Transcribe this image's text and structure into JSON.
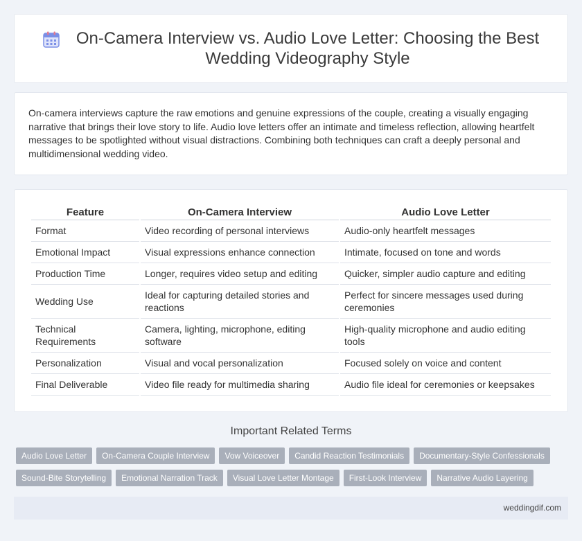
{
  "header": {
    "title": "On-Camera Interview vs. Audio Love Letter: Choosing the Best Wedding Videography Style",
    "icon": "calendar-icon",
    "icon_color": "#7b8fe6"
  },
  "intro": {
    "text": "On-camera interviews capture the raw emotions and genuine expressions of the couple, creating a visually engaging narrative that brings their love story to life. Audio love letters offer an intimate and timeless reflection, allowing heartfelt messages to be spotlighted without visual distractions. Combining both techniques can craft a deeply personal and multidimensional wedding video."
  },
  "table": {
    "headers": [
      "Feature",
      "On-Camera Interview",
      "Audio Love Letter"
    ],
    "rows": [
      [
        "Format",
        "Video recording of personal interviews",
        "Audio-only heartfelt messages"
      ],
      [
        "Emotional Impact",
        "Visual expressions enhance connection",
        "Intimate, focused on tone and words"
      ],
      [
        "Production Time",
        "Longer, requires video setup and editing",
        "Quicker, simpler audio capture and editing"
      ],
      [
        "Wedding Use",
        "Ideal for capturing detailed stories and reactions",
        "Perfect for sincere messages used during ceremonies"
      ],
      [
        "Technical Requirements",
        "Camera, lighting, microphone, editing software",
        "High-quality microphone and audio editing tools"
      ],
      [
        "Personalization",
        "Visual and vocal personalization",
        "Focused solely on voice and content"
      ],
      [
        "Final Deliverable",
        "Video file ready for multimedia sharing",
        "Audio file ideal for ceremonies or keepsakes"
      ]
    ]
  },
  "related": {
    "title": "Important Related Terms",
    "tags": [
      "Audio Love Letter",
      "On-Camera Couple Interview",
      "Vow Voiceover",
      "Candid Reaction Testimonials",
      "Documentary-Style Confessionals",
      "Sound-Bite Storytelling",
      "Emotional Narration Track",
      "Visual Love Letter Montage",
      "First-Look Interview",
      "Narrative Audio Layering"
    ]
  },
  "footer": {
    "site": "weddingdif.com"
  }
}
